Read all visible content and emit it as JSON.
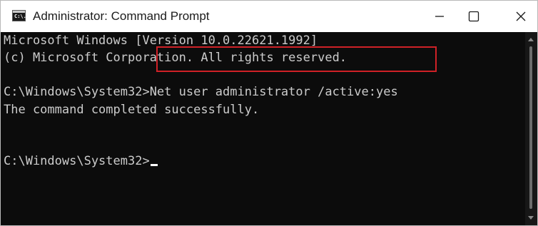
{
  "window": {
    "title": "Administrator: Command Prompt",
    "icon": "cmd-icon",
    "icon_glyph": "C:\\.",
    "controls": {
      "minimize": "minimize-icon",
      "maximize": "maximize-icon",
      "close": "close-icon"
    }
  },
  "console": {
    "lines": [
      "Microsoft Windows [Version 10.0.22621.1992]",
      "(c) Microsoft Corporation. All rights reserved.",
      "C:\\Windows\\System32>Net user administrator /active:yes",
      "The command completed successfully.",
      "C:\\Windows\\System32>"
    ],
    "text_color": "#cccccc",
    "background": "#0c0c0c",
    "highlight_color": "#cf2127"
  }
}
